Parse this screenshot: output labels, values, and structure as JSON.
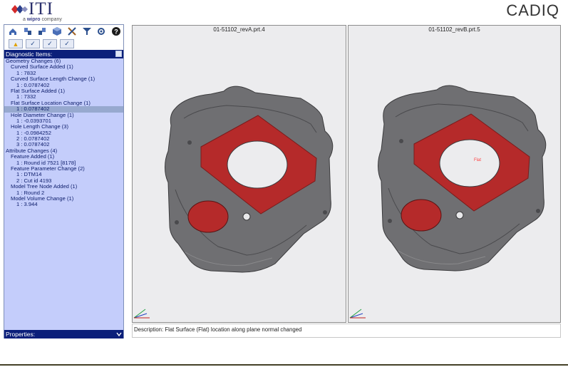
{
  "header": {
    "logo_text": "ITI",
    "logo_sub_prefix": "a ",
    "logo_sub_brand": "wipro",
    "logo_sub_suffix": " company",
    "app_name": "CADIQ"
  },
  "toolbar": {
    "buttons": [
      "home-icon",
      "compare-icon",
      "models-icon",
      "cube-icon",
      "tools-icon",
      "filter-icon",
      "settings-icon",
      "help-icon"
    ],
    "toggles": [
      "warning-toggle",
      "geometry-toggle",
      "check-filter-toggle",
      "check-list-toggle"
    ]
  },
  "diagnostic": {
    "header": "Diagnostic Items:",
    "items": [
      {
        "level": 0,
        "text": "Geometry Changes (6)"
      },
      {
        "level": 1,
        "text": "Curved Surface Added (1)"
      },
      {
        "level": 2,
        "text": "1 : 7832"
      },
      {
        "level": 1,
        "text": "Curved Surface Length Change (1)"
      },
      {
        "level": 2,
        "text": "1 : 0.0787402"
      },
      {
        "level": 1,
        "text": "Flat Surface Added (1)"
      },
      {
        "level": 2,
        "text": "1 : 7332"
      },
      {
        "level": 1,
        "text": "Flat Surface Location Change (1)"
      },
      {
        "level": 2,
        "text": "1 : 0.0787402",
        "selected": true
      },
      {
        "level": 1,
        "text": "Hole Diameter Change (1)"
      },
      {
        "level": 2,
        "text": "1 : -0.0393701"
      },
      {
        "level": 1,
        "text": "Hole Length Change (3)"
      },
      {
        "level": 2,
        "text": "1 : -0.0984252"
      },
      {
        "level": 2,
        "text": "2 : 0.0787402"
      },
      {
        "level": 2,
        "text": "3 : 0.0787402"
      },
      {
        "level": 0,
        "text": "Attribute Changes (4)"
      },
      {
        "level": 1,
        "text": "Feature Added (1)"
      },
      {
        "level": 2,
        "text": "1 : Round id 7521 [8178]"
      },
      {
        "level": 1,
        "text": "Feature Parameter Change (2)"
      },
      {
        "level": 2,
        "text": "1 : DTM14"
      },
      {
        "level": 2,
        "text": "2 : Cut id 4193"
      },
      {
        "level": 1,
        "text": "Model Tree Node Added (1)"
      },
      {
        "level": 2,
        "text": "1 : Round 2"
      },
      {
        "level": 1,
        "text": "Model Volume Change (1)"
      },
      {
        "level": 2,
        "text": "1 : 3.944"
      }
    ]
  },
  "properties": {
    "header": "Properties:"
  },
  "viewports": {
    "left_title": "01-51102_revA.prt.4",
    "right_title": "01-51102_revB.prt.5",
    "right_annotation": "Flat"
  },
  "description": "Description: Flat Surface (Flat) location along plane normal changed",
  "colors": {
    "part_gray": "#6f6f72",
    "highlight_red": "#b52a2a",
    "tree_bg": "#c4cdfb",
    "header_bg": "#0b1f7a"
  }
}
